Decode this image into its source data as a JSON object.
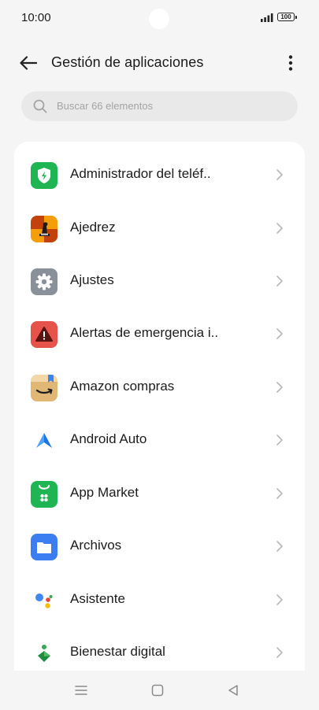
{
  "status_bar": {
    "time": "10:00",
    "battery": "100"
  },
  "header": {
    "title": "Gestión de aplicaciones",
    "back_icon": "arrow-left-icon",
    "more_icon": "more-vertical-icon"
  },
  "search": {
    "placeholder": "Buscar 66 elementos",
    "icon": "search-icon"
  },
  "apps": [
    {
      "label": "Administrador del teléf..",
      "icon": "phone-manager-icon",
      "color": "#1fb552"
    },
    {
      "label": "Ajedrez",
      "icon": "chess-icon",
      "color": "#e2600f"
    },
    {
      "label": "Ajustes",
      "icon": "gear-icon",
      "color": "#8a9099"
    },
    {
      "label": "Alertas de emergencia i..",
      "icon": "warning-icon",
      "color": "#e5534b"
    },
    {
      "label": "Amazon compras",
      "icon": "amazon-icon",
      "color": "#e1b775"
    },
    {
      "label": "Android Auto",
      "icon": "android-auto-icon",
      "color": "#4285f4"
    },
    {
      "label": "App Market",
      "icon": "shopping-bag-icon",
      "color": "#1fb552"
    },
    {
      "label": "Archivos",
      "icon": "folder-icon",
      "color": "#3b7ef2"
    },
    {
      "label": "Asistente",
      "icon": "google-assistant-icon",
      "color": "#4285f4"
    },
    {
      "label": "Bienestar digital",
      "icon": "digital-wellbeing-icon",
      "color": "#34a853"
    }
  ],
  "nav_bar": {
    "menu_icon": "menu-icon",
    "home_icon": "home-square-icon",
    "back_icon": "back-triangle-icon"
  }
}
